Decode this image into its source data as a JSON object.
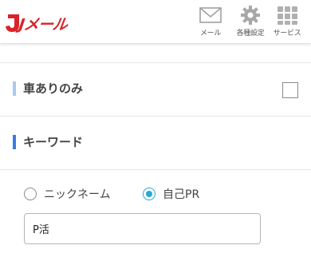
{
  "header": {
    "logo_text": "Jメール",
    "nav": {
      "mail": {
        "label": "メール",
        "icon": "envelope-icon"
      },
      "settings": {
        "label": "各種設定",
        "icon": "gear-icon"
      },
      "service": {
        "label": "サービス",
        "icon": "grid-icon"
      }
    }
  },
  "filters": {
    "car_only": {
      "label": "車ありのみ",
      "checked": false
    },
    "keyword": {
      "title": "キーワード",
      "options": [
        {
          "label": "ニックネーム",
          "selected": false
        },
        {
          "label": "自己PR",
          "selected": true
        }
      ],
      "value": "P活"
    }
  },
  "colors": {
    "brand": "#d9232a",
    "accent_bar_light": "#a9c9f2",
    "accent_bar": "#3a7be0",
    "radio_selected": "#2aa6d8"
  }
}
